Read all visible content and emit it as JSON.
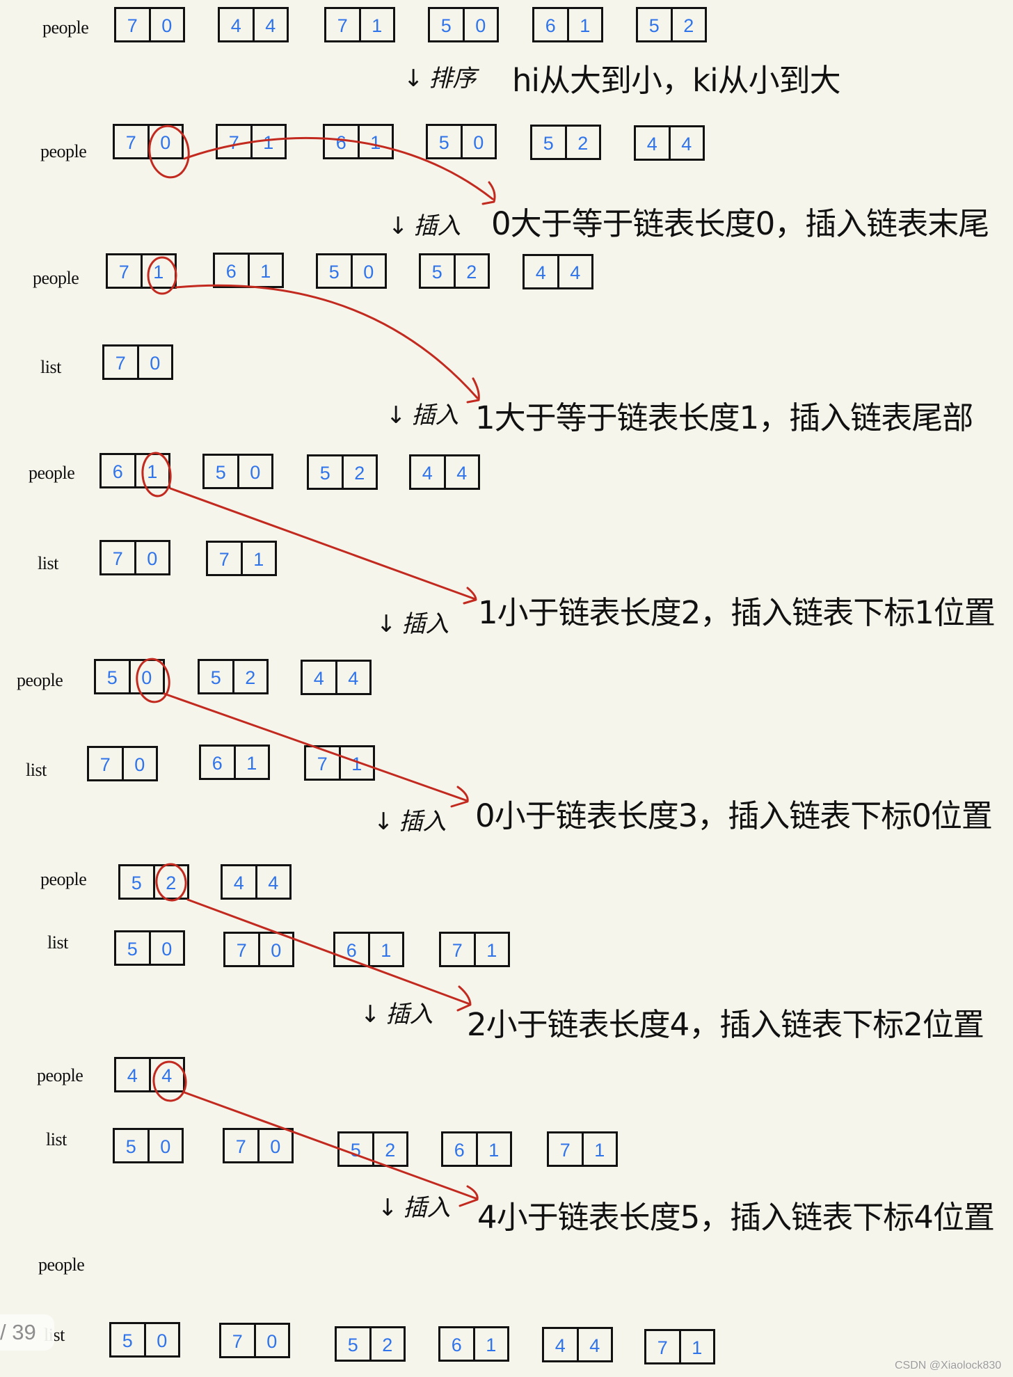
{
  "colors": {
    "background": "#f6f5ec",
    "digit": "#2f74ea",
    "annotation_red": "#c22a1f",
    "ink": "#111111"
  },
  "labels": {
    "people": "people",
    "list": "list"
  },
  "stages": [
    {
      "people": [
        [
          7,
          0
        ],
        [
          4,
          4
        ],
        [
          7,
          1
        ],
        [
          5,
          0
        ],
        [
          6,
          1
        ],
        [
          5,
          2
        ]
      ],
      "list": []
    },
    {
      "people": [
        [
          7,
          0
        ],
        [
          7,
          1
        ],
        [
          6,
          1
        ],
        [
          5,
          0
        ],
        [
          5,
          2
        ],
        [
          4,
          4
        ]
      ],
      "list": [],
      "circled": "people[0].k"
    },
    {
      "people": [
        [
          7,
          1
        ],
        [
          6,
          1
        ],
        [
          5,
          0
        ],
        [
          5,
          2
        ],
        [
          4,
          4
        ]
      ],
      "list": [
        [
          7,
          0
        ]
      ],
      "circled": "people[0].k"
    },
    {
      "people": [
        [
          6,
          1
        ],
        [
          5,
          0
        ],
        [
          5,
          2
        ],
        [
          4,
          4
        ]
      ],
      "list": [
        [
          7,
          0
        ],
        [
          7,
          1
        ]
      ],
      "circled": "people[0].k"
    },
    {
      "people": [
        [
          5,
          0
        ],
        [
          5,
          2
        ],
        [
          4,
          4
        ]
      ],
      "list": [
        [
          7,
          0
        ],
        [
          6,
          1
        ],
        [
          7,
          1
        ]
      ],
      "circled": "people[0].k"
    },
    {
      "people": [
        [
          5,
          2
        ],
        [
          4,
          4
        ]
      ],
      "list": [
        [
          5,
          0
        ],
        [
          7,
          0
        ],
        [
          6,
          1
        ],
        [
          7,
          1
        ]
      ],
      "circled": "people[0].k"
    },
    {
      "people": [
        [
          4,
          4
        ]
      ],
      "list": [
        [
          5,
          0
        ],
        [
          7,
          0
        ],
        [
          5,
          2
        ],
        [
          6,
          1
        ],
        [
          7,
          1
        ]
      ],
      "circled": "people[0].k"
    },
    {
      "people": [],
      "list": [
        [
          5,
          0
        ],
        [
          7,
          0
        ],
        [
          5,
          2
        ],
        [
          6,
          1
        ],
        [
          4,
          4
        ],
        [
          7,
          1
        ]
      ]
    }
  ],
  "transitions": [
    {
      "arrow": "↓",
      "word": "排序",
      "text": "hi从大到小，ki从小到大"
    },
    {
      "arrow": "↓",
      "word": "插入",
      "text": "0大于等于链表长度0，插入链表末尾"
    },
    {
      "arrow": "↓",
      "word": "插入",
      "text": "1大于等于链表长度1，插入链表尾部"
    },
    {
      "arrow": "↓",
      "word": "插入",
      "text": "1小于链表长度2，插入链表下标1位置"
    },
    {
      "arrow": "↓",
      "word": "插入",
      "text": "0小于链表长度3，插入链表下标0位置"
    },
    {
      "arrow": "↓",
      "word": "插入",
      "text": "2小于链表长度4，插入链表下标2位置"
    },
    {
      "arrow": "↓",
      "word": "插入",
      "text": "4小于链表长度5，插入链表下标4位置"
    }
  ],
  "viewer": {
    "page_indicator": "/ 39"
  },
  "watermark": "CSDN @Xiaolock830"
}
